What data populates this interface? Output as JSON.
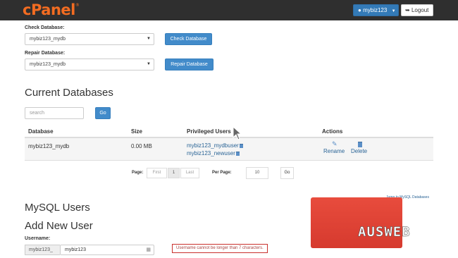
{
  "header": {
    "logo_text": "cPanel",
    "logo_mark": "®",
    "user_label": "mybiz123",
    "logout_label": "Logout"
  },
  "check": {
    "label": "Check Database:",
    "selected": "mybiz123_mydb",
    "button": "Check Database"
  },
  "repair": {
    "label": "Repair Database:",
    "selected": "mybiz123_mydb",
    "button": "Repair Database"
  },
  "current_databases": {
    "title": "Current Databases",
    "search_placeholder": "search",
    "go_label": "Go",
    "columns": [
      "Database",
      "Size",
      "Privileged Users",
      "Actions"
    ],
    "rows": [
      {
        "database": "mybiz123_mydb",
        "size": "0.00 MB",
        "users": [
          "mybiz123_mydbuser",
          "mybiz123_newuser"
        ],
        "actions": [
          "Rename",
          "Delete"
        ]
      }
    ]
  },
  "pagination": {
    "page_label": "Page:",
    "first": "First",
    "current": "1",
    "last": "Last",
    "per_page_label": "Per Page:",
    "per_page_value": "10",
    "go_label": "Go"
  },
  "jump_link": "Jump to MySQL Databases",
  "mysql_users": {
    "title": "MySQL Users",
    "add_title": "Add New User",
    "username_label": "Username:",
    "prefix": "mybiz123_",
    "username_value": "mybiz123",
    "warning": "Username cannot be longer than 7 characters."
  },
  "watermark": {
    "text": "AUSWEB",
    "color": "#e84c3d"
  }
}
